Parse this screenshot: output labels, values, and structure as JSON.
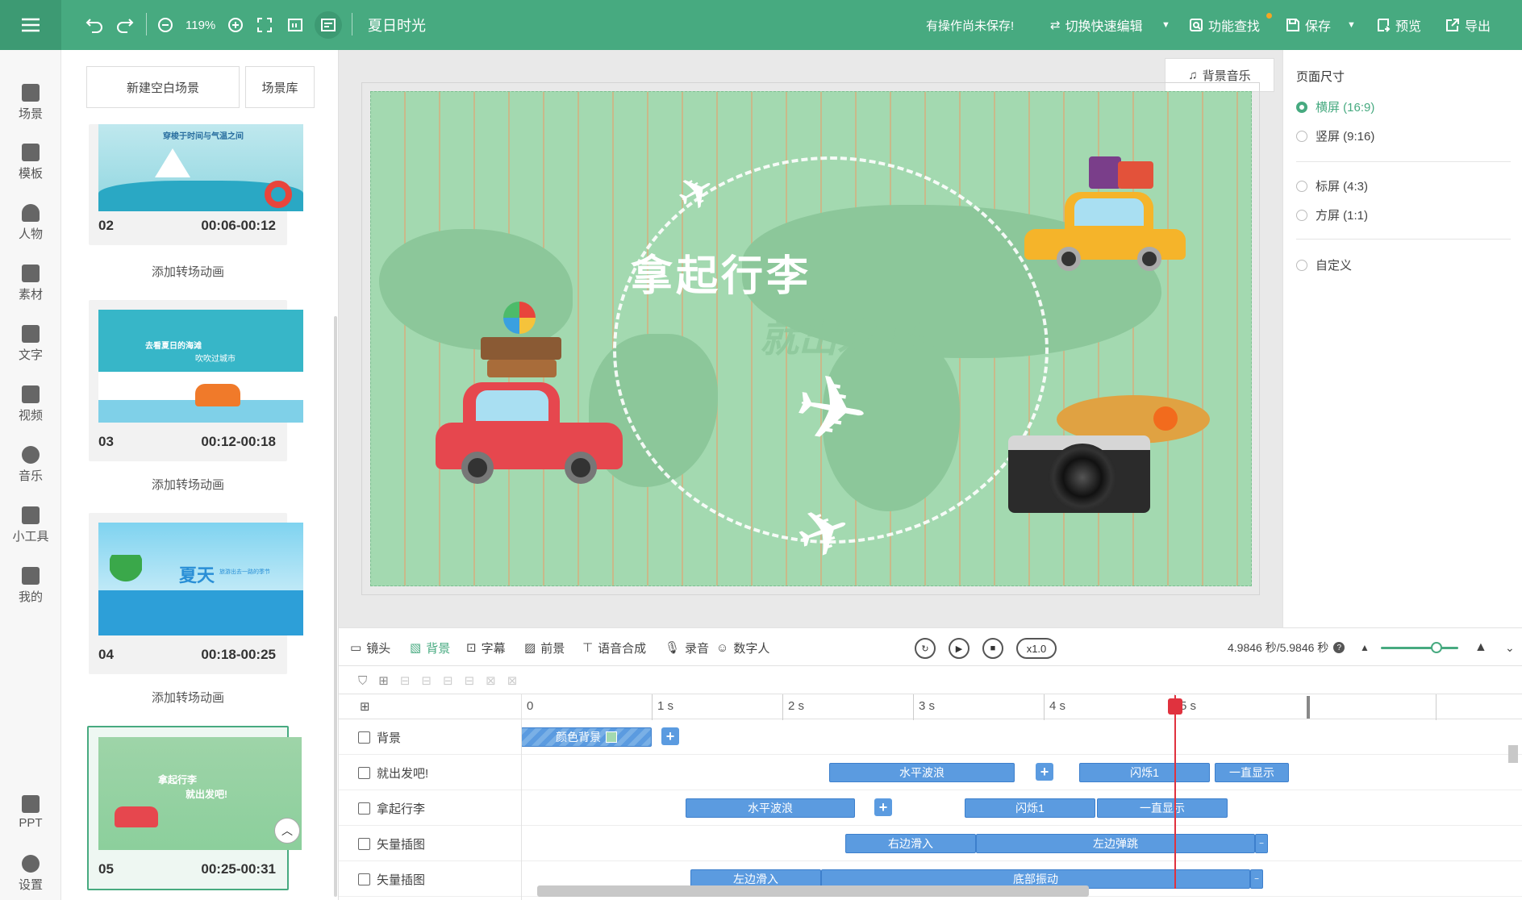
{
  "app": {
    "project_title": "夏日时光",
    "zoom": "119%",
    "unsaved_notice": "有操作尚未保存!",
    "switch_edit": "切换快速编辑",
    "feature_search": "功能查找",
    "save": "保存",
    "preview": "预览",
    "export": "导出"
  },
  "nav": [
    {
      "label": "场景",
      "icon": "scene-icon"
    },
    {
      "label": "模板",
      "icon": "template-icon"
    },
    {
      "label": "人物",
      "icon": "person-icon"
    },
    {
      "label": "素材",
      "icon": "material-icon"
    },
    {
      "label": "文字",
      "icon": "text-icon"
    },
    {
      "label": "视频",
      "icon": "video-icon"
    },
    {
      "label": "音乐",
      "icon": "music-icon"
    },
    {
      "label": "小工具",
      "icon": "toolbox-icon"
    },
    {
      "label": "我的",
      "icon": "upload-icon"
    },
    {
      "label": "PPT",
      "icon": "ppt-icon"
    },
    {
      "label": "设置",
      "icon": "gear-icon"
    }
  ],
  "scenes": {
    "new_blank": "新建空白场景",
    "library": "场景库",
    "add_transition": "添加转场动画",
    "items": [
      {
        "num": "02",
        "time": "00:06-00:12",
        "thumb_text": "穿梭于时间与气温之间"
      },
      {
        "num": "03",
        "time": "00:12-00:18",
        "thumb_text": "去看夏日的海滩",
        "thumb_text2": "吹吹过城市"
      },
      {
        "num": "04",
        "time": "00:18-00:25",
        "thumb_text": "夏天",
        "thumb_text2": "旅游出去一路的季节"
      },
      {
        "num": "05",
        "time": "00:25-00:31",
        "thumb_text": "拿起行李",
        "thumb_text2": "就出发吧!"
      }
    ]
  },
  "canvas": {
    "bg_music": "背景音乐",
    "title_text": "拿起行李",
    "subtitle_text": "就出发吧!"
  },
  "page_size": {
    "heading": "页面尺寸",
    "options": [
      {
        "label": "横屏 (16:9)",
        "selected": true
      },
      {
        "label": "竖屏 (9:16)",
        "selected": false
      },
      {
        "label": "标屏 (4:3)",
        "selected": false
      },
      {
        "label": "方屏 (1:1)",
        "selected": false
      },
      {
        "label": "自定义",
        "selected": false
      }
    ]
  },
  "toolbar": {
    "camera": "镜头",
    "background": "背景",
    "subtitle": "字幕",
    "foreground": "前景",
    "tts": "语音合成",
    "record": "录音",
    "digital_human": "数字人",
    "speed": "x1.0",
    "time": "4.9846 秒/5.9846 秒"
  },
  "timeline": {
    "ticks": [
      "0",
      "1 s",
      "2 s",
      "3 s",
      "4 s",
      "5 s"
    ],
    "rows": [
      {
        "label": "背景",
        "clips": [
          {
            "text": "颜色背景"
          }
        ]
      },
      {
        "label": "就出发吧!",
        "clips": [
          {
            "text": "水平波浪"
          },
          {
            "text": "闪烁1"
          },
          {
            "text": "一直显示"
          }
        ]
      },
      {
        "label": "拿起行李",
        "clips": [
          {
            "text": "水平波浪"
          },
          {
            "text": "闪烁1"
          },
          {
            "text": "一直显示"
          }
        ]
      },
      {
        "label": "矢量插图",
        "clips": [
          {
            "text": "右边滑入"
          },
          {
            "text": "左边弹跳"
          }
        ]
      },
      {
        "label": "矢量插图",
        "clips": [
          {
            "text": "左边滑入"
          },
          {
            "text": "底部振动"
          }
        ]
      }
    ]
  },
  "colors": {
    "accent": "#47aa80",
    "clip": "#5b9be0",
    "playhead": "#e0323e",
    "canvas_bg": "#a3d9b0"
  }
}
